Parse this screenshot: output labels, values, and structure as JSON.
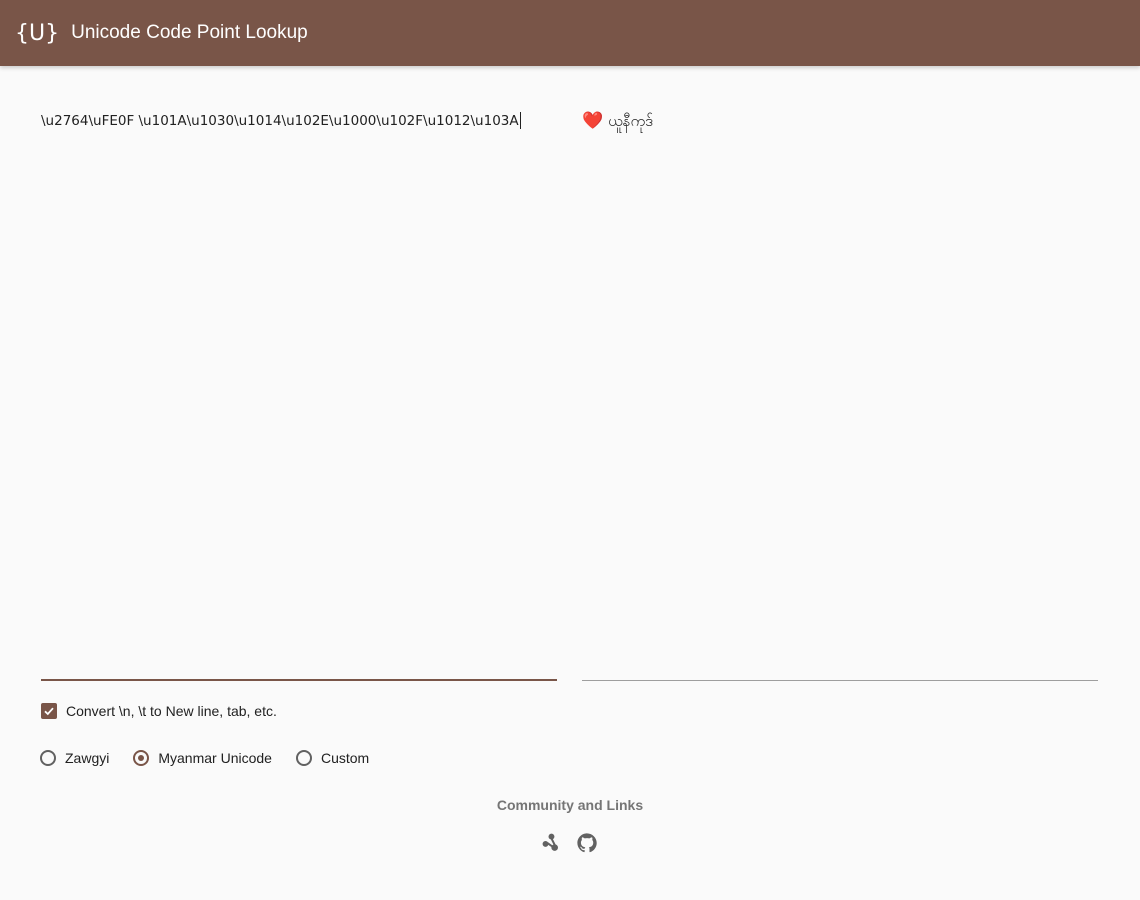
{
  "appbar": {
    "logo_text": "{U}",
    "title": "Unicode Code Point Lookup",
    "background": "#795548"
  },
  "input": {
    "value": "\\u2764\\uFE0F \\u101A\\u1030\\u1014\\u102E\\u1000\\u102F\\u1012\\u103A"
  },
  "output": {
    "emoji": "❤️",
    "text": "ယူနီကုဒ်"
  },
  "options": {
    "convert_escapes": {
      "label": "Convert \\n, \\t to New line, tab, etc.",
      "checked": true
    },
    "font_mode": {
      "items": [
        {
          "label": "Zawgyi",
          "selected": false
        },
        {
          "label": "Myanmar Unicode",
          "selected": true
        },
        {
          "label": "Custom",
          "selected": false
        }
      ]
    }
  },
  "footer": {
    "title": "Community and Links",
    "icons": [
      "community-icon",
      "github-icon"
    ]
  },
  "colors": {
    "accent": "#795548",
    "background": "#fafafa",
    "muted": "#757575"
  }
}
